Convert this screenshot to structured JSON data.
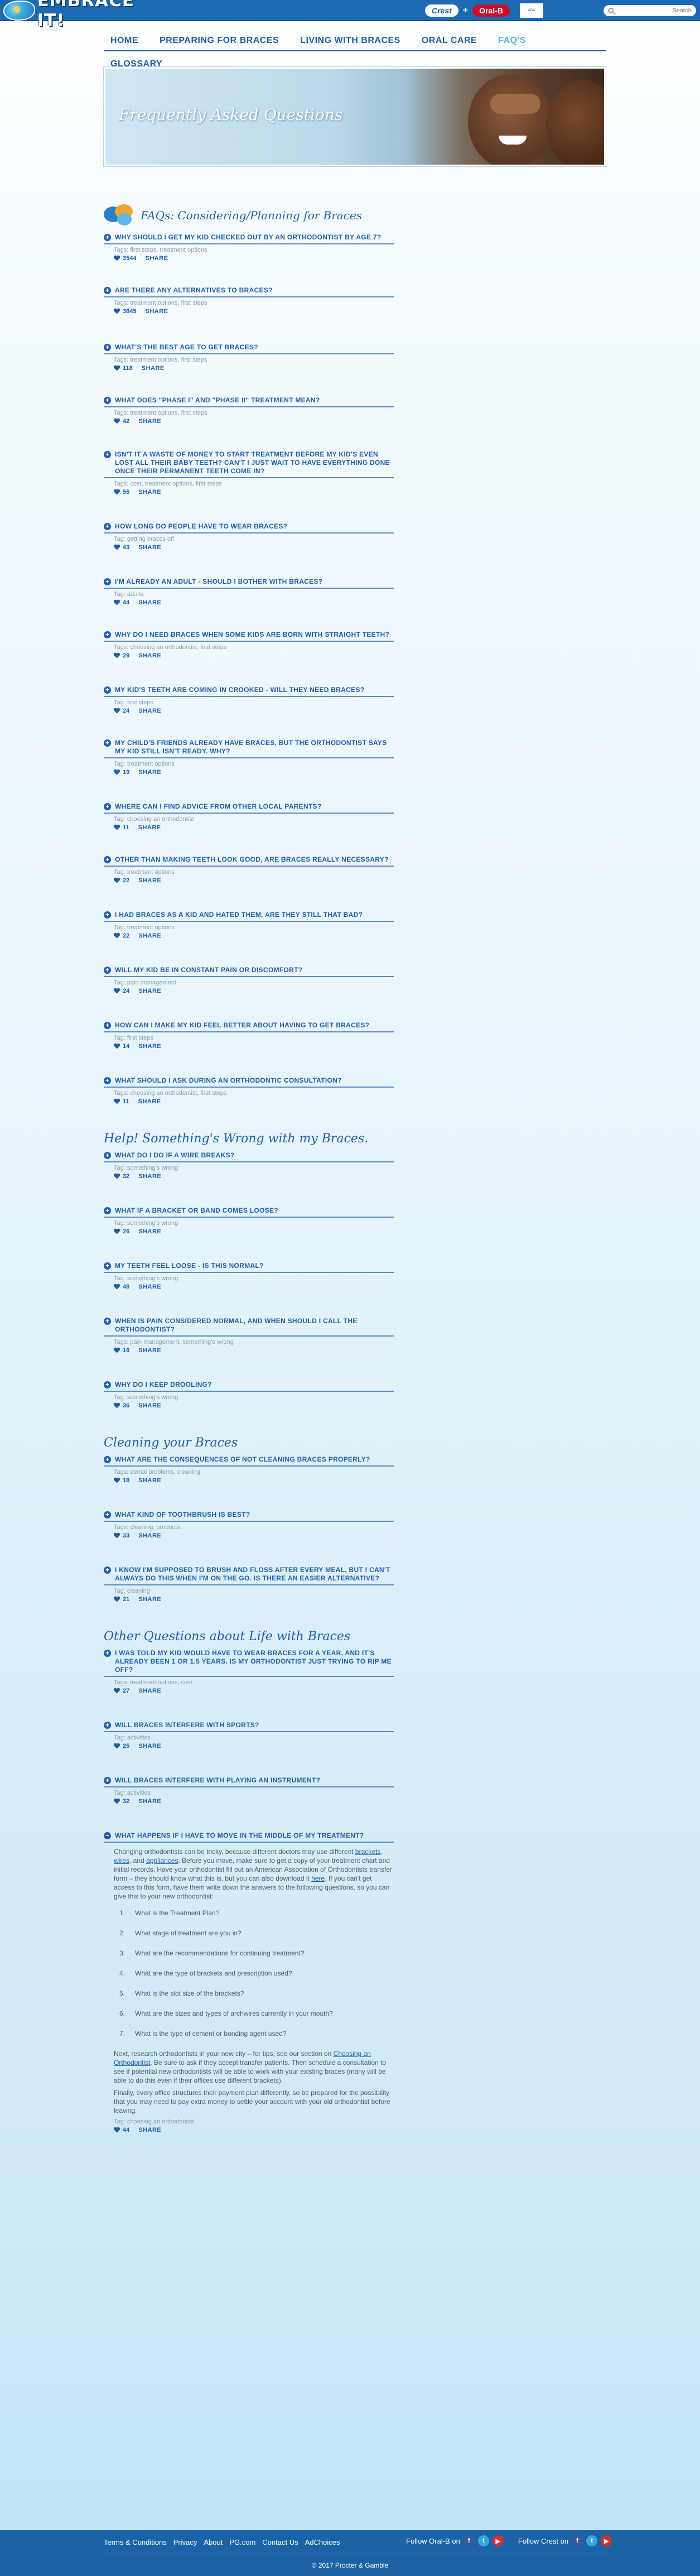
{
  "header": {
    "logo_text": "EMBRACE IT!",
    "brands": [
      "Crest",
      "+",
      "Oral-B"
    ],
    "ada_seal_text": "ADA",
    "search": {
      "placeholder": "",
      "label": "Search"
    }
  },
  "nav": {
    "row1": [
      {
        "label": "HOME",
        "active": false
      },
      {
        "label": "PREPARING FOR BRACES",
        "active": false
      },
      {
        "label": "LIVING WITH BRACES",
        "active": false
      },
      {
        "label": "ORAL CARE",
        "active": false
      },
      {
        "label": "FAQ'S",
        "active": true
      }
    ],
    "row2": [
      {
        "label": "GLOSSARY",
        "active": false
      }
    ]
  },
  "banner": {
    "title": "Frequently Asked Questions"
  },
  "groups": [
    {
      "title": "FAQs: Considering/Planning for Braces",
      "items": [
        {
          "q": "Why should I get my kid checked out by an orthodontist by age 7?",
          "tags": "Tags: first steps, treatment options",
          "likes": "3544"
        },
        {
          "q": "Are there any alternatives to braces?",
          "tags": "Tags: treatment options, first steps",
          "likes": "3645"
        },
        {
          "q": "What's the best age to get braces?",
          "tags": "Tags: treatment options, first steps",
          "likes": "118"
        },
        {
          "q": "What does \"Phase I\" and \"Phase II\" treatment mean?",
          "tags": "Tags: treatment options, first steps",
          "likes": "42"
        },
        {
          "q": "Isn't it a waste of money to start treatment before my kid's even lost all their baby teeth? Can't I just wait to have everything done once their permanent teeth come in?",
          "tags": "Tags: cost, treatment options, first steps",
          "likes": "55"
        },
        {
          "q": "How long do people have to wear braces?",
          "tags": "Tag: getting braces off",
          "likes": "43"
        },
        {
          "q": "I'm already an adult - should I bother with braces?",
          "tags": "Tag: adults",
          "likes": "44"
        },
        {
          "q": "Why do I need braces when some kids are born with straight teeth?",
          "tags": "Tags: choosing an orthodontist, first steps",
          "likes": "29"
        },
        {
          "q": "My kid's teeth are coming in crooked - will they need braces?",
          "tags": "Tag: first steps",
          "likes": "24"
        },
        {
          "q": "My child's friends already have braces, but the orthodontist says my kid still isn't ready. Why?",
          "tags": "Tag: treatment options",
          "likes": "19"
        },
        {
          "q": "Where can I find advice from other local parents?",
          "tags": "Tag: choosing an orthodontist",
          "likes": "11"
        },
        {
          "q": "Other than making teeth look good, are braces really necessary?",
          "tags": "Tag: treatment options",
          "likes": "22"
        },
        {
          "q": "I had braces as a kid and hated them. Are they still that bad?",
          "tags": "Tag: treatment options",
          "likes": "22"
        },
        {
          "q": "Will my kid be in constant pain or discomfort?",
          "tags": "Tag: pain management",
          "likes": "24"
        },
        {
          "q": "How can I make my kid feel better about having to get braces?",
          "tags": "Tag: first steps",
          "likes": "14"
        },
        {
          "q": "What should I ask during an orthodontic consultation?",
          "tags": "Tags: choosing an orthodontist, first steps",
          "likes": "11"
        }
      ]
    },
    {
      "title": "Help! Something's Wrong with my Braces.",
      "items": [
        {
          "q": "What do I do if a wire breaks?",
          "tags": "Tag: something's wrong",
          "likes": "32"
        },
        {
          "q": "What if a bracket or band comes loose?",
          "tags": "Tag: something's wrong",
          "likes": "26"
        },
        {
          "q": "My teeth feel loose - is this normal?",
          "tags": "Tag: something's wrong",
          "likes": "48"
        },
        {
          "q": "When is pain considered normal, and when should I call the orthodontist?",
          "tags": "Tags: pain management, something's wrong",
          "likes": "16"
        },
        {
          "q": "Why do I keep drooling?",
          "tags": "Tag: something's wrong",
          "likes": "36"
        }
      ]
    },
    {
      "title": "Cleaning your Braces",
      "items": [
        {
          "q": "What are the consequences of not cleaning braces properly?",
          "tags": "Tags: dental problems, cleaning",
          "likes": "18"
        },
        {
          "q": "What kind of toothbrush is best?",
          "tags": "Tags: cleaning, products",
          "likes": "33"
        },
        {
          "q": "I know I'm supposed to brush and floss after every meal, but I can't always do this when I'm on the go. Is there an easier alternative?",
          "tags": "Tag: cleaning",
          "likes": "21"
        }
      ]
    },
    {
      "title": "Other Questions about Life with Braces",
      "items": [
        {
          "q": "I was told my kid would have to wear braces for a year, and it's already been 1 or 1.5 years. Is my orthodontist just trying to rip me off?",
          "tags": "Tags: treatment options, cost",
          "likes": "27"
        },
        {
          "q": "Will braces interfere with sports?",
          "tags": "Tag: activities",
          "likes": "25"
        },
        {
          "q": "Will braces interfere with playing an instrument?",
          "tags": "Tag: activities",
          "likes": "32"
        }
      ]
    }
  ],
  "expanded": {
    "q": "What happens if I have to move in the middle of my treatment?",
    "intro": "Changing orthodontists can be tricky, because different doctors may use different brackets, wires, and appliances. Before you move, make sure to get a copy of your treatment chart and initial records. Have your orthodontist fill out an American Association of Orthodontists transfer form – they should know what this is, but you can also download it here. If you can't get access to this form, have them write down the answers to the following questions, so you can give this to your new orthodontist:",
    "list": [
      "What is the Treatment Plan?",
      "What stage of treatment are you in?",
      "What are the recommendations for continuing treatment?",
      "What are the type of brackets and prescription used?",
      "What is the slot size of the brackets?",
      "What are the sizes and types of archwires currently in your mouth?",
      "What is the type of cement or bonding agent used?"
    ],
    "para2": "Next, research orthodontists in your new city – for tips, see our section on Choosing an Orthodontist. Be sure to ask if they accept transfer patients. Then schedule a consultation to see if potential new orthodontists will be able to work with your existing braces (many will be able to do this even if their offices use different brackets).",
    "para3": "Finally, every office structures their payment plan differently, so be prepared for the possibility that you may need to pay extra money to settle your account with your old orthodontist before leaving.",
    "tags": "Tag: choosing an orthodontist",
    "likes": "44"
  },
  "share_label": "SHARE",
  "footer": {
    "links": [
      "Terms & Conditions",
      "Privacy",
      "About",
      "PG.com",
      "Contact Us",
      "AdChoices"
    ],
    "follow_oralb": "Follow Oral-B on",
    "follow_crest": "Follow Crest on",
    "copyright": "© 2017 Procter & Gamble"
  },
  "colors": {
    "primary": "#1d5fab",
    "active_nav": "#4fb6e6",
    "topbar": "#1d6ab3",
    "footer": "#1b63a6"
  }
}
